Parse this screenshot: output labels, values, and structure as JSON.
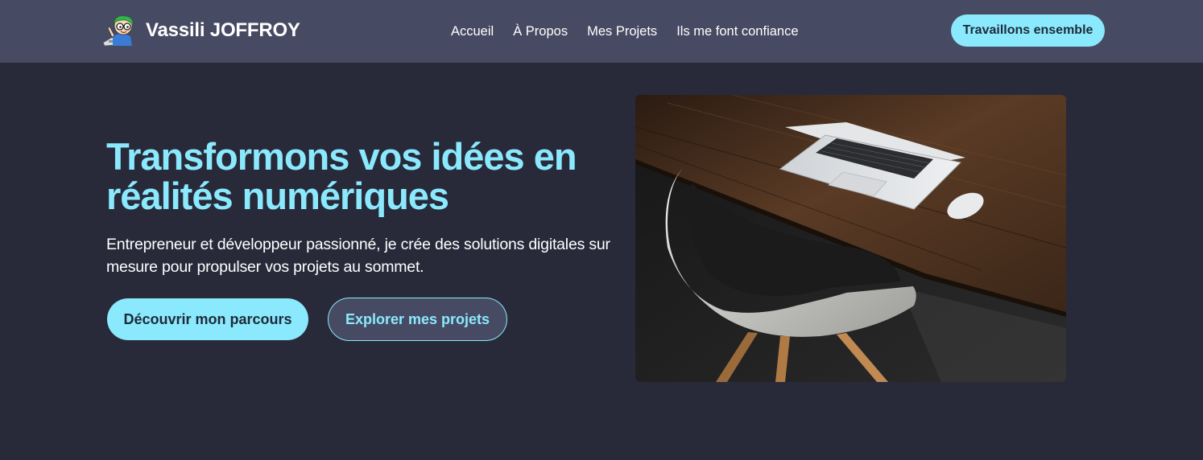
{
  "header": {
    "brand_name": "Vassili JOFFROY",
    "logo_icon": "developer-avatar-icon",
    "nav": [
      {
        "label": "Accueil"
      },
      {
        "label": "À Propos"
      },
      {
        "label": "Mes Projets"
      },
      {
        "label": "Ils me font confiance"
      }
    ],
    "cta_label": "Travaillons ensemble"
  },
  "hero": {
    "title": "Transformons vos idées en réalités numériques",
    "subtitle": "Entrepreneur et développeur passionné, je crée des solutions digitales sur mesure pour propulser vos projets au sommet.",
    "primary_button": "Découvrir mon parcours",
    "secondary_button": "Explorer mes projets"
  },
  "colors": {
    "accent": "#8be9fd",
    "header_bg": "#474a63",
    "page_bg": "#282a3a",
    "button_text": "#1e2a38"
  }
}
